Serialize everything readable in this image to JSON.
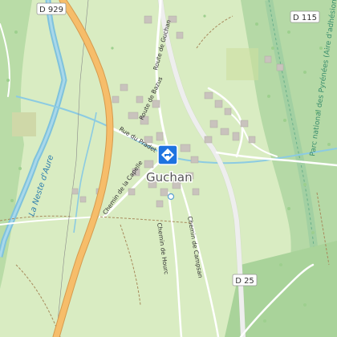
{
  "map": {
    "town": "Guchan",
    "river": "La Neste d'Aure",
    "park": "Parc national des Pyrénées (Aire d'adhésion)",
    "roads": {
      "d929": "D 929",
      "d115": "D 115",
      "d25": "D 25"
    },
    "streets": {
      "route_guchan": "Route de Guchan",
      "route_bazus": "Route de Bazus",
      "rue_pradet": "Rue du Pradet",
      "chemin_capelle": "Chemin de la Capelle",
      "chemin_hourc": "Chemin de Hourc",
      "chemin_campsan": "Chemin de Campsan"
    },
    "colors": {
      "meadow": "#d9ecc2",
      "forest": "#b8dba8",
      "water": "#7fc2dc",
      "main_road": "#f4b35c",
      "marker": "#1e73e0"
    },
    "marker_icon": "location-marker-icon"
  }
}
